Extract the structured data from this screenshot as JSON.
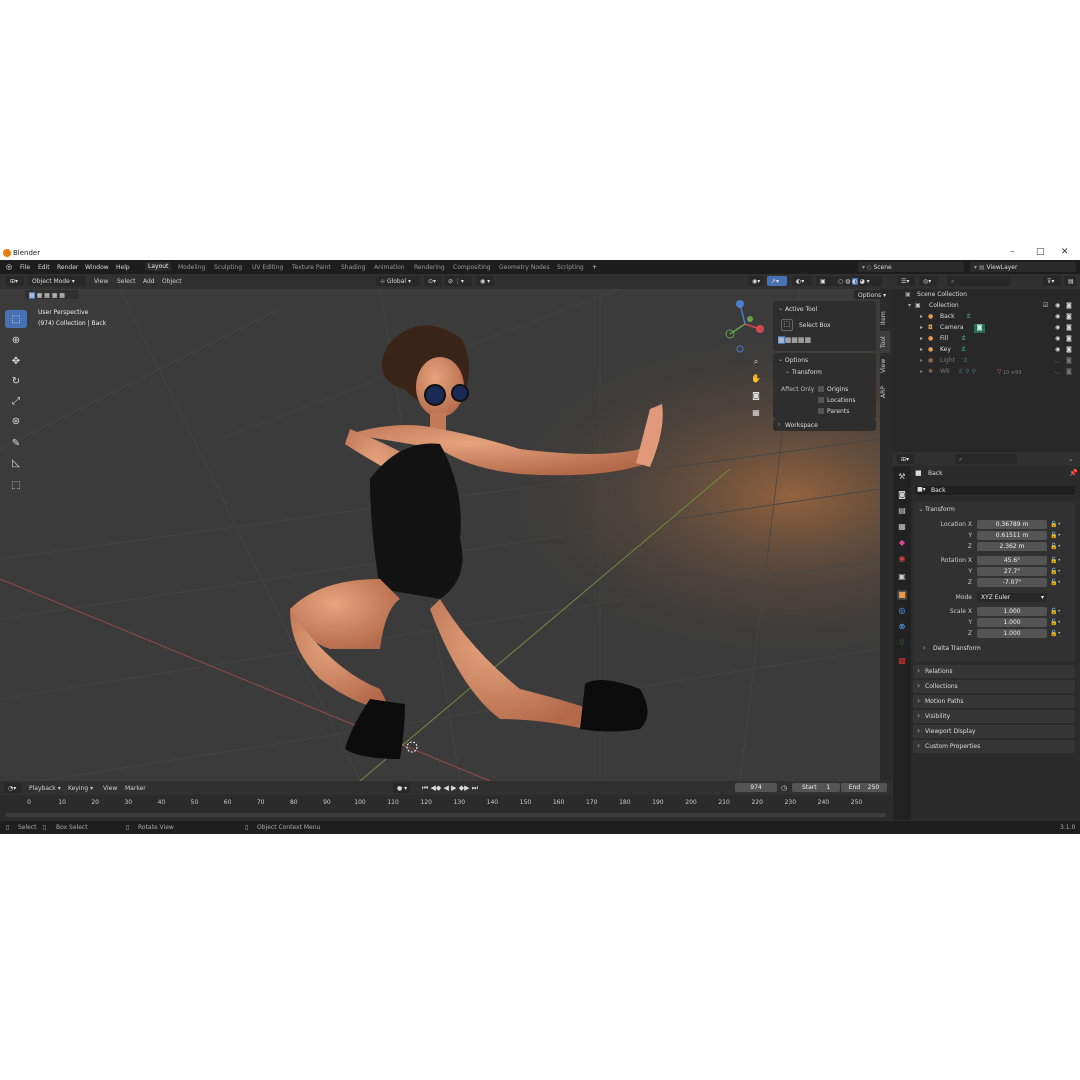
{
  "window": {
    "title": "Blender",
    "version": "3.1.0"
  },
  "menu": [
    "File",
    "Edit",
    "Render",
    "Window",
    "Help"
  ],
  "workspaces": [
    "Layout",
    "Modeling",
    "Sculpting",
    "UV Editing",
    "Texture Paint",
    "Shading",
    "Animation",
    "Rendering",
    "Compositing",
    "Geometry Nodes",
    "Scripting",
    "+"
  ],
  "active_workspace": "Layout",
  "scene": {
    "name": "Scene",
    "view_layer": "ViewLayer"
  },
  "viewport": {
    "mode": "Object Mode",
    "menus": [
      "View",
      "Select",
      "Add",
      "Object"
    ],
    "orientation": "Global",
    "options_label": "Options",
    "info_line1": "User Perspective",
    "info_line2": "(974) Collection | Back",
    "tabs": [
      "Item",
      "Tool",
      "View",
      "ARP"
    ]
  },
  "tool_panel": {
    "active_tool_title": "Active Tool",
    "tool_name": "Select Box",
    "options_title": "Options",
    "transform_title": "Transform",
    "affect_only": "Affect Only",
    "checks": [
      "Origins",
      "Locations",
      "Parents"
    ],
    "workspace_title": "Workspace"
  },
  "outliner": {
    "root": "Scene Collection",
    "collection": "Collection",
    "items": [
      {
        "name": "Back",
        "color": "#e89a4a"
      },
      {
        "name": "Camera",
        "color": "#e89a4a"
      },
      {
        "name": "Fill",
        "color": "#e89a4a"
      },
      {
        "name": "Key",
        "color": "#e89a4a"
      },
      {
        "name": "Light",
        "color": "#8a7a6a"
      },
      {
        "name": "W6",
        "color": "#8a7a6a"
      }
    ],
    "w6_counts": "10 ≡99"
  },
  "properties": {
    "object_name": "Back",
    "data_name": "Back",
    "transform_title": "Transform",
    "location": {
      "label": "Location X",
      "x": "0.36789 m",
      "y": "0.61511 m",
      "z": "2.362 m"
    },
    "rotation": {
      "label": "Rotation X",
      "x": "45.6°",
      "y": "27.7°",
      "z": "-7.07°"
    },
    "mode_label": "Mode",
    "mode_value": "XYZ Euler",
    "scale": {
      "label": "Scale X",
      "x": "1.000",
      "y": "1.000",
      "z": "1.000"
    },
    "axis_y": "Y",
    "axis_z": "Z",
    "delta": "Delta Transform",
    "sections": [
      "Relations",
      "Collections",
      "Motion Paths",
      "Visibility",
      "Viewport Display",
      "Custom Properties"
    ]
  },
  "timeline": {
    "menus": [
      "Playback",
      "Keying",
      "View",
      "Marker"
    ],
    "current_frame": "974",
    "start_label": "Start",
    "start": "1",
    "end_label": "End",
    "end": "250",
    "ticks": [
      "0",
      "10",
      "20",
      "30",
      "40",
      "50",
      "60",
      "70",
      "80",
      "90",
      "100",
      "110",
      "120",
      "130",
      "140",
      "150",
      "160",
      "170",
      "180",
      "190",
      "200",
      "210",
      "220",
      "230",
      "240",
      "250"
    ]
  },
  "status": {
    "select": "Select",
    "box_select": "Box Select",
    "rotate": "Rotate View",
    "context": "Object Context Menu"
  }
}
